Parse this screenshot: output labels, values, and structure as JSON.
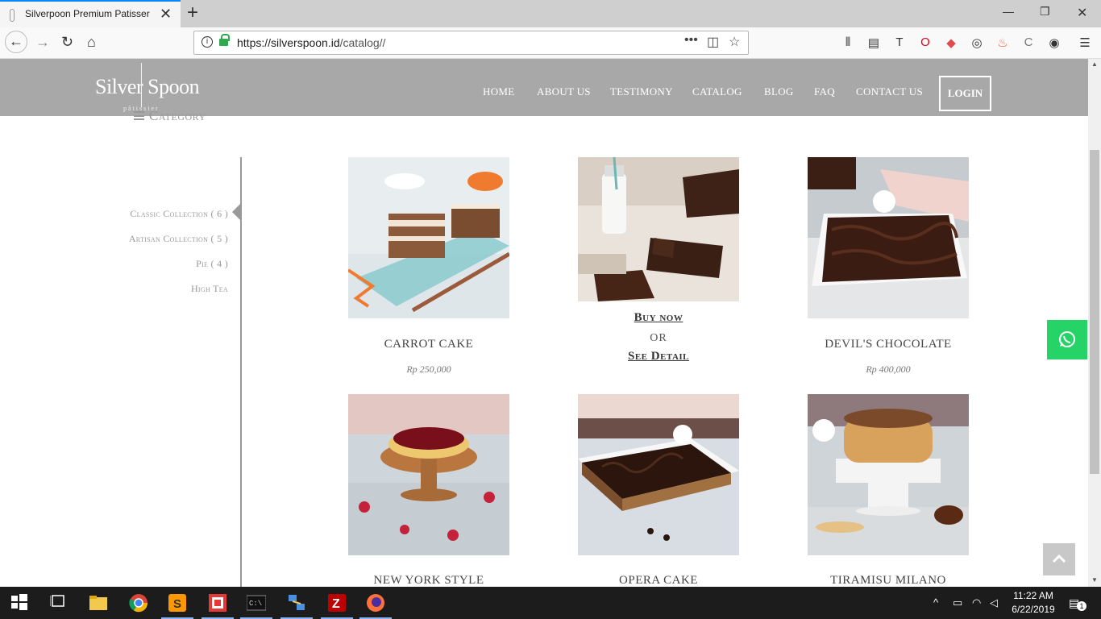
{
  "browser": {
    "tab_title": "Silverpoon Premium Patisser",
    "url_domain": "https://silverspoon.id",
    "url_path": "/catalog//",
    "more_label": "•••"
  },
  "site": {
    "logo": {
      "left": "Silver",
      "right": "Spoon",
      "sub": "pâtissier"
    },
    "menu": [
      "HOME",
      "ABOUT US",
      "TESTIMONY",
      "CATALOG",
      "BLOG",
      "FAQ",
      "CONTACT US"
    ],
    "login": "LOGIN",
    "category_title": "Category",
    "categories": [
      {
        "label": "Classic Collection ( 6 )",
        "active": true
      },
      {
        "label": "Artisan Collection ( 5 )",
        "active": false
      },
      {
        "label": "Pie ( 4 )",
        "active": false
      },
      {
        "label": "High Tea",
        "active": false
      }
    ],
    "products": [
      {
        "name": "CARROT CAKE",
        "price": "Rp 250,000"
      },
      {
        "buy": "Buy now",
        "or": "OR",
        "detail": "See Detail"
      },
      {
        "name": "DEVIL'S CHOCOLATE",
        "price": "Rp 400,000"
      },
      {
        "name": "NEW YORK STYLE"
      },
      {
        "name": "OPERA CAKE"
      },
      {
        "name": "TIRAMISU MILANO"
      }
    ]
  },
  "taskbar": {
    "time": "11:22 AM",
    "date": "6/22/2019",
    "notification_count": "1"
  },
  "colors": {
    "header": "#a8a8a8",
    "whatsapp": "#25d366",
    "chocolate": "#3a1f14"
  }
}
